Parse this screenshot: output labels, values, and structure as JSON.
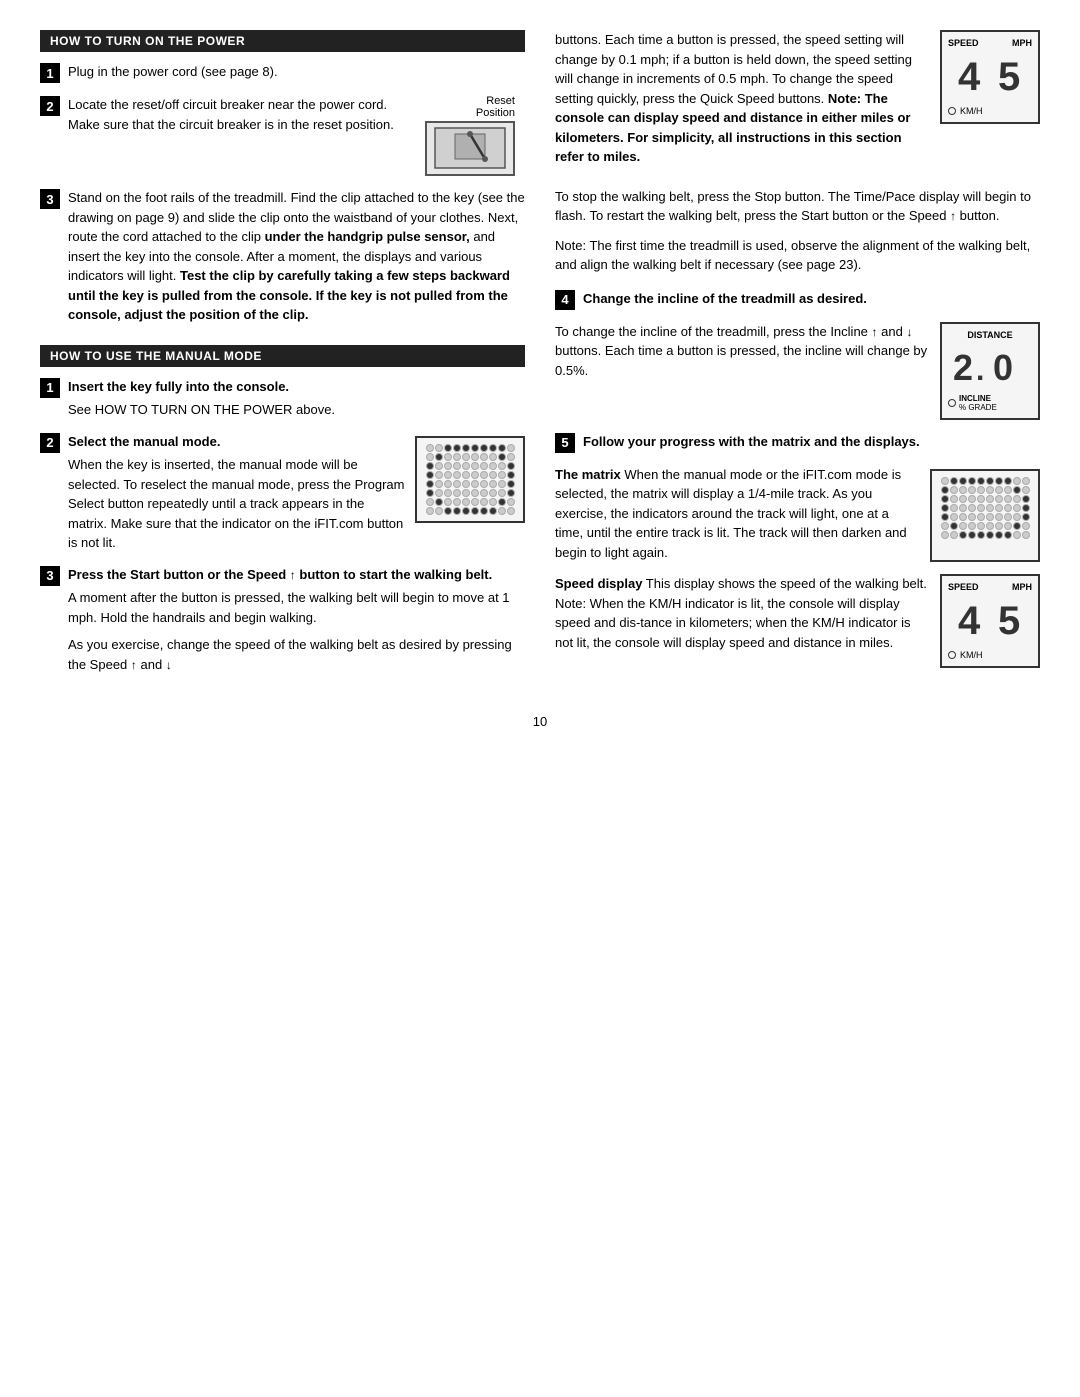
{
  "page": {
    "number": "10"
  },
  "left_col": {
    "section1": {
      "header": "HOW TO TURN ON THE POWER",
      "step1": {
        "num": "1",
        "text": "Plug in the power cord (see page 8)."
      },
      "step2": {
        "num": "2",
        "text1": "Locate the reset/off circuit breaker near the power cord. Make sure that the circuit breaker is in the reset position.",
        "reset_label": "Reset",
        "position_label": "Position"
      },
      "step3": {
        "num": "3",
        "text": "Stand on the foot rails of the treadmill. Find the clip attached to the key (see the drawing on page 9) and slide the clip onto the waistband of your clothes. Next, route the cord attached to the clip ",
        "bold1": "under the handgrip pulse sensor,",
        "text2": " and insert the key into the console. After a moment, the displays and various indicators will light. ",
        "bold2": "Test the clip by carefully taking a few steps backward until the key is pulled from the console. If the key is not pulled from the console, adjust the position of the clip."
      }
    },
    "section2": {
      "header": "HOW TO USE THE MANUAL MODE",
      "step1": {
        "num": "1",
        "bold": "Insert the key fully into the console.",
        "text": "See HOW TO TURN ON THE POWER above."
      },
      "step2": {
        "num": "2",
        "bold": "Select the manual mode.",
        "text": "When the key is inserted, the manual mode will be selected. To reselect the manual mode, press the Program Select button repeatedly until a track appears in the matrix. Make sure that the indicator on the iFIT.com button is not lit."
      },
      "step3": {
        "num": "3",
        "bold": "Press the Start button or the Speed",
        "arrow": "↑",
        "bold2": " button to start the walking belt.",
        "text": "A moment after the button is pressed, the walking belt will begin to move at 1 mph. Hold the handrails and begin walking.",
        "text2": "As you exercise, change the speed of the walking belt as desired by pressing the Speed",
        "up_arrow": "↑",
        "and": " and",
        "down_arrow": " ↓"
      }
    }
  },
  "right_col": {
    "intro": {
      "text1": "buttons. Each time a button is pressed, the speed setting will change by 0.1 mph; if a button is held down, the speed setting will change in increments of 0.5 mph. To change the speed setting quickly, press the Quick Speed buttons. ",
      "bold": "Note: The console can display speed and distance in either miles or kilometers. For simplicity, all instructions in this section refer to miles."
    },
    "stop_para": {
      "text": "To stop the walking belt, press the Stop button. The Time/Pace display will begin to flash. To restart the walking belt, press the Start button or the Speed",
      "arrow": "↑",
      "text2": " button."
    },
    "note_para": {
      "text": "Note: The first time the treadmill is used, observe the alignment of the walking belt, and align the walking belt if necessary (see page 23)."
    },
    "step4": {
      "num": "4",
      "bold": "Change the incline of the treadmill as desired.",
      "text": "To change the incline of the treadmill, press the Incline",
      "up": "↑",
      "and": " and",
      "down": " ↓",
      "text2": " buttons. Each time a button is pressed, the incline will change by 0.5%.",
      "display": {
        "header": "DISTANCE",
        "number": "2.0",
        "footer1": "INCLINE",
        "footer2": "% GRADE"
      }
    },
    "step5": {
      "num": "5",
      "bold": "Follow your progress with the matrix and the displays.",
      "matrix_label": "The matrix",
      "matrix_text": " When the manual mode or the iFIT.com mode is selected, the matrix will display a 1/4-mile track. As you exercise, the indicators around the track will light, one at a time, until the entire track is lit. The track will then darken and begin to light again.",
      "speed_label": "Speed display",
      "speed_text": " This display shows the speed of the walking belt. Note: When the KM/H indicator is lit, the console will display speed and dis-tance in kilometers; when the KM/H indicator is not lit, the console will display speed and distance in miles.",
      "speed_display": {
        "header1": "SPEED",
        "header2": "MPH",
        "number": "45",
        "footer": "KM/H"
      }
    }
  }
}
